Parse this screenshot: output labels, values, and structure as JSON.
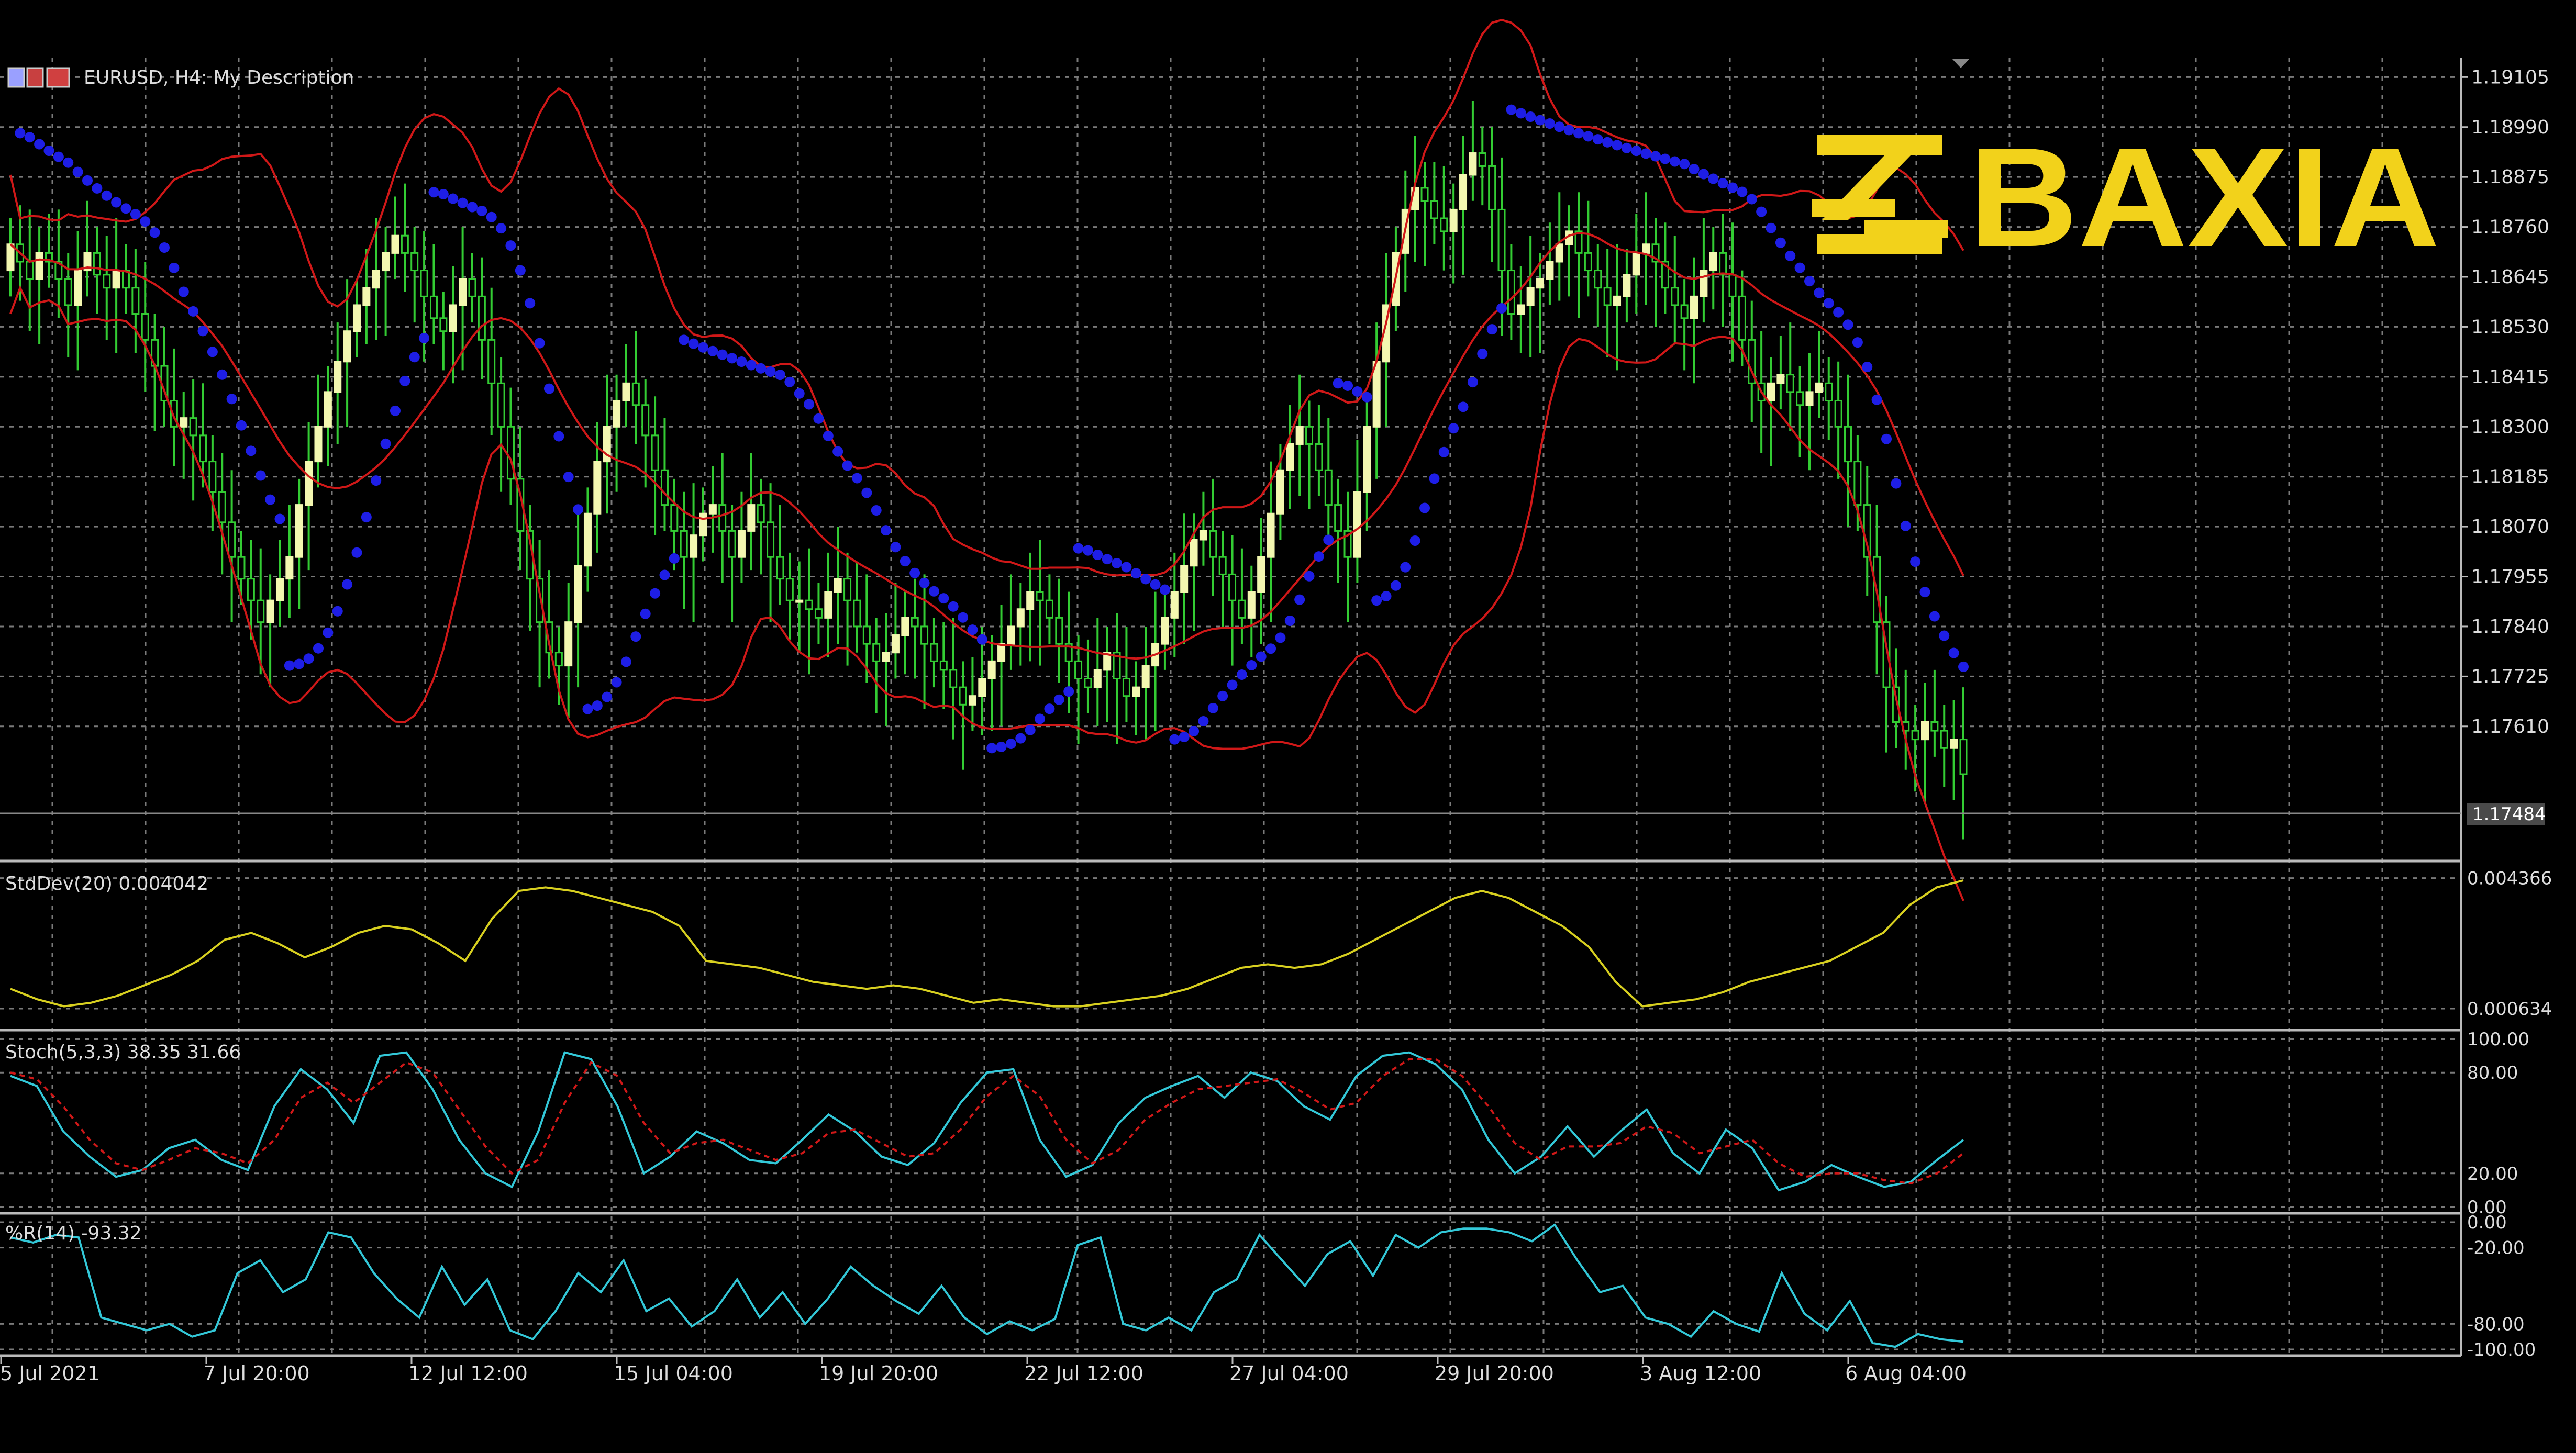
{
  "window": {
    "symbol_line": "EURUSD, H4:  My Description",
    "current_price": "1.17484"
  },
  "brand": {
    "name": "BAXIA",
    "color": "#F2D21B"
  },
  "colors": {
    "background": "#000000",
    "grid": "#7a7a7a",
    "bull_candle": "#F3F7B0",
    "bear_wick": "#33CC33",
    "bollinger": "#D01818",
    "sar": "#1E1EE6",
    "stddev": "#D8D020",
    "stoch_main": "#33C8D8",
    "stoch_signal": "#D01818",
    "wpr": "#33C8D8"
  },
  "chart_data": [
    {
      "type": "candlestick",
      "panel": "main",
      "symbol": "EURUSD",
      "timeframe": "H4",
      "indicators": [
        "Bollinger Bands",
        "Parabolic SAR"
      ],
      "y_ticks": [
        "1.19105",
        "1.18990",
        "1.18875",
        "1.18760",
        "1.18645",
        "1.18530",
        "1.18415",
        "1.18300",
        "1.18185",
        "1.18070",
        "1.17955",
        "1.17840",
        "1.17725",
        "1.17610"
      ],
      "ylim": [
        1.173,
        1.1915
      ],
      "last_price": 1.17484,
      "x_tick_labels": [
        "5 Jul 2021",
        "7 Jul 20:00",
        "12 Jul 12:00",
        "15 Jul 04:00",
        "19 Jul 20:00",
        "22 Jul 12:00",
        "27 Jul 04:00",
        "29 Jul 20:00",
        "3 Aug 12:00",
        "6 Aug 04:00"
      ],
      "close": [
        1.1872,
        1.1868,
        1.1864,
        1.187,
        1.1868,
        1.1864,
        1.1858,
        1.1866,
        1.187,
        1.1865,
        1.1862,
        1.1866,
        1.1862,
        1.1856,
        1.185,
        1.1844,
        1.1836,
        1.183,
        1.1832,
        1.1828,
        1.1822,
        1.1815,
        1.1808,
        1.18,
        1.1795,
        1.179,
        1.1785,
        1.179,
        1.1795,
        1.18,
        1.1812,
        1.1822,
        1.183,
        1.1838,
        1.1845,
        1.1852,
        1.1858,
        1.1862,
        1.1866,
        1.187,
        1.1874,
        1.187,
        1.1866,
        1.186,
        1.1855,
        1.1852,
        1.1858,
        1.1864,
        1.186,
        1.185,
        1.184,
        1.183,
        1.1818,
        1.1806,
        1.1795,
        1.1785,
        1.1778,
        1.1775,
        1.1785,
        1.1798,
        1.181,
        1.1822,
        1.183,
        1.1836,
        1.184,
        1.1835,
        1.1828,
        1.182,
        1.1812,
        1.1806,
        1.18,
        1.1805,
        1.181,
        1.1812,
        1.1806,
        1.18,
        1.1806,
        1.1812,
        1.1808,
        1.18,
        1.1795,
        1.179,
        1.179,
        1.1788,
        1.1786,
        1.1792,
        1.1795,
        1.179,
        1.1784,
        1.178,
        1.1776,
        1.1778,
        1.1782,
        1.1786,
        1.1784,
        1.178,
        1.1776,
        1.1774,
        1.177,
        1.1766,
        1.1768,
        1.1772,
        1.1776,
        1.178,
        1.1784,
        1.1788,
        1.1792,
        1.179,
        1.1786,
        1.178,
        1.1776,
        1.1772,
        1.177,
        1.1774,
        1.1778,
        1.1772,
        1.1768,
        1.177,
        1.1775,
        1.178,
        1.1786,
        1.1792,
        1.1798,
        1.1804,
        1.1806,
        1.18,
        1.1796,
        1.179,
        1.1786,
        1.1792,
        1.18,
        1.181,
        1.182,
        1.1826,
        1.183,
        1.1826,
        1.182,
        1.1812,
        1.1806,
        1.18,
        1.1815,
        1.183,
        1.1845,
        1.1858,
        1.187,
        1.188,
        1.1885,
        1.1882,
        1.1878,
        1.1875,
        1.188,
        1.1888,
        1.1893,
        1.189,
        1.188,
        1.1866,
        1.1856,
        1.1858,
        1.1862,
        1.1864,
        1.1868,
        1.1872,
        1.1875,
        1.187,
        1.1866,
        1.1862,
        1.1858,
        1.186,
        1.1865,
        1.187,
        1.1872,
        1.1868,
        1.1862,
        1.1858,
        1.1855,
        1.186,
        1.1866,
        1.187,
        1.1865,
        1.186,
        1.185,
        1.184,
        1.1836,
        1.184,
        1.1842,
        1.1838,
        1.1835,
        1.1838,
        1.184,
        1.1836,
        1.183,
        1.1822,
        1.1812,
        1.18,
        1.1785,
        1.177,
        1.1762,
        1.176,
        1.1758,
        1.1762,
        1.176,
        1.1756,
        1.1758,
        1.175
      ],
      "open": [
        1.1866,
        1.1872,
        1.1868,
        1.1864,
        1.187,
        1.1868,
        1.1864,
        1.1858,
        1.1866,
        1.187,
        1.1865,
        1.1862,
        1.1866,
        1.1862,
        1.1856,
        1.185,
        1.1844,
        1.1836,
        1.183,
        1.1832,
        1.1828,
        1.1822,
        1.1815,
        1.1808,
        1.18,
        1.1795,
        1.179,
        1.1785,
        1.179,
        1.1795,
        1.18,
        1.1812,
        1.1822,
        1.183,
        1.1838,
        1.1845,
        1.1852,
        1.1858,
        1.1862,
        1.1866,
        1.187,
        1.1874,
        1.187,
        1.1866,
        1.186,
        1.1855,
        1.1852,
        1.1858,
        1.1864,
        1.186,
        1.185,
        1.184,
        1.183,
        1.1818,
        1.1806,
        1.1795,
        1.1785,
        1.1778,
        1.1775,
        1.1785,
        1.1798,
        1.181,
        1.1822,
        1.183,
        1.1836,
        1.184,
        1.1835,
        1.1828,
        1.182,
        1.1812,
        1.1806,
        1.18,
        1.1805,
        1.181,
        1.1812,
        1.1806,
        1.18,
        1.1806,
        1.1812,
        1.1808,
        1.18,
        1.1795,
        1.179,
        1.179,
        1.1788,
        1.1786,
        1.1792,
        1.1795,
        1.179,
        1.1784,
        1.178,
        1.1776,
        1.1778,
        1.1782,
        1.1786,
        1.1784,
        1.178,
        1.1776,
        1.1774,
        1.177,
        1.1766,
        1.1768,
        1.1772,
        1.1776,
        1.178,
        1.1784,
        1.1788,
        1.1792,
        1.179,
        1.1786,
        1.178,
        1.1776,
        1.1772,
        1.177,
        1.1774,
        1.1778,
        1.1772,
        1.1768,
        1.177,
        1.1775,
        1.178,
        1.1786,
        1.1792,
        1.1798,
        1.1804,
        1.1806,
        1.18,
        1.1796,
        1.179,
        1.1786,
        1.1792,
        1.18,
        1.181,
        1.182,
        1.1826,
        1.183,
        1.1826,
        1.182,
        1.1812,
        1.1806,
        1.18,
        1.1815,
        1.183,
        1.1845,
        1.1858,
        1.187,
        1.188,
        1.1885,
        1.1882,
        1.1878,
        1.1875,
        1.188,
        1.1888,
        1.1893,
        1.189,
        1.188,
        1.1866,
        1.1856,
        1.1858,
        1.1862,
        1.1864,
        1.1868,
        1.1872,
        1.1875,
        1.187,
        1.1866,
        1.1862,
        1.1858,
        1.186,
        1.1865,
        1.187,
        1.1872,
        1.1868,
        1.1862,
        1.1858,
        1.1855,
        1.186,
        1.1866,
        1.187,
        1.1865,
        1.186,
        1.185,
        1.184,
        1.1836,
        1.184,
        1.1842,
        1.1838,
        1.1835,
        1.1838,
        1.184,
        1.1836,
        1.183,
        1.1822,
        1.1812,
        1.18,
        1.1785,
        1.177,
        1.1762,
        1.176,
        1.1758,
        1.1762,
        1.176,
        1.1756,
        1.1758
      ]
    },
    {
      "type": "line",
      "panel": "stddev",
      "label": "StdDev(20) 0.004042",
      "y_ticks": [
        "0.004366",
        "0.000634"
      ],
      "ylim": [
        0.0002,
        0.0046
      ],
      "series": [
        {
          "values": [
            0.0012,
            0.0009,
            0.0007,
            0.0008,
            0.001,
            0.0013,
            0.0016,
            0.002,
            0.0026,
            0.0028,
            0.0025,
            0.0021,
            0.0024,
            0.0028,
            0.003,
            0.0029,
            0.0025,
            0.002,
            0.0032,
            0.004,
            0.0041,
            0.004,
            0.0038,
            0.0036,
            0.0034,
            0.003,
            0.002,
            0.0019,
            0.0018,
            0.0016,
            0.0014,
            0.0013,
            0.0012,
            0.0013,
            0.0012,
            0.001,
            0.0008,
            0.0009,
            0.0008,
            0.0007,
            0.0007,
            0.0008,
            0.0009,
            0.001,
            0.0012,
            0.0015,
            0.0018,
            0.0019,
            0.0018,
            0.0019,
            0.0022,
            0.0026,
            0.003,
            0.0034,
            0.0038,
            0.004,
            0.0038,
            0.0034,
            0.003,
            0.0024,
            0.0014,
            0.0007,
            0.0008,
            0.0009,
            0.0011,
            0.0014,
            0.0016,
            0.0018,
            0.002,
            0.0024,
            0.0028,
            0.0036,
            0.0041,
            0.0043
          ]
        }
      ]
    },
    {
      "type": "line",
      "panel": "stochastic",
      "label": "Stoch(5,3,3) 38.35 31.66",
      "y_ticks": [
        "100.00",
        "80.00",
        "20.00",
        "0.00"
      ],
      "ylim": [
        0,
        100
      ],
      "series": [
        {
          "values": [
            78,
            72,
            45,
            30,
            18,
            22,
            35,
            40,
            28,
            22,
            60,
            82,
            70,
            50,
            90,
            92,
            70,
            40,
            20,
            12,
            45,
            92,
            88,
            60,
            20,
            30,
            45,
            38,
            28,
            26,
            40,
            55,
            45,
            30,
            25,
            38,
            62,
            80,
            82,
            40,
            18,
            25,
            50,
            65,
            72,
            78,
            65,
            80,
            75,
            60,
            52,
            78,
            90,
            92,
            85,
            70,
            40,
            20,
            30,
            48,
            30,
            45,
            58,
            32,
            20,
            46,
            35,
            10,
            15,
            25,
            18,
            12,
            15,
            28,
            40
          ]
        },
        {
          "values": [
            80,
            76,
            60,
            40,
            26,
            22,
            28,
            35,
            32,
            26,
            40,
            65,
            74,
            62,
            74,
            86,
            80,
            58,
            36,
            20,
            28,
            62,
            86,
            78,
            50,
            32,
            38,
            40,
            34,
            28,
            32,
            44,
            46,
            38,
            30,
            32,
            46,
            66,
            78,
            66,
            40,
            26,
            34,
            52,
            62,
            70,
            72,
            74,
            76,
            68,
            58,
            62,
            78,
            88,
            88,
            78,
            60,
            38,
            28,
            36,
            36,
            38,
            48,
            44,
            32,
            36,
            40,
            26,
            18,
            20,
            20,
            16,
            14,
            20,
            32
          ]
        }
      ]
    },
    {
      "type": "line",
      "panel": "williams",
      "label": "%R(14) -93.32",
      "y_ticks": [
        "0.00",
        "-20.00",
        "-80.00",
        "-100.00"
      ],
      "ylim": [
        -100,
        0
      ],
      "series": [
        {
          "values": [
            -12,
            -16,
            -10,
            -12,
            -75,
            -80,
            -85,
            -80,
            -90,
            -85,
            -40,
            -30,
            -55,
            -45,
            -8,
            -12,
            -40,
            -60,
            -75,
            -35,
            -65,
            -45,
            -85,
            -92,
            -70,
            -40,
            -55,
            -30,
            -70,
            -60,
            -82,
            -70,
            -45,
            -75,
            -55,
            -80,
            -60,
            -35,
            -50,
            -62,
            -72,
            -50,
            -75,
            -88,
            -78,
            -85,
            -76,
            -18,
            -12,
            -80,
            -85,
            -75,
            -85,
            -55,
            -45,
            -10,
            -30,
            -50,
            -25,
            -15,
            -42,
            -10,
            -20,
            -8,
            -5,
            -5,
            -8,
            -15,
            -2,
            -30,
            -55,
            -50,
            -75,
            -80,
            -90,
            -70,
            -80,
            -86,
            -40,
            -72,
            -85,
            -62,
            -95,
            -98,
            -88,
            -92,
            -94
          ]
        }
      ]
    }
  ]
}
